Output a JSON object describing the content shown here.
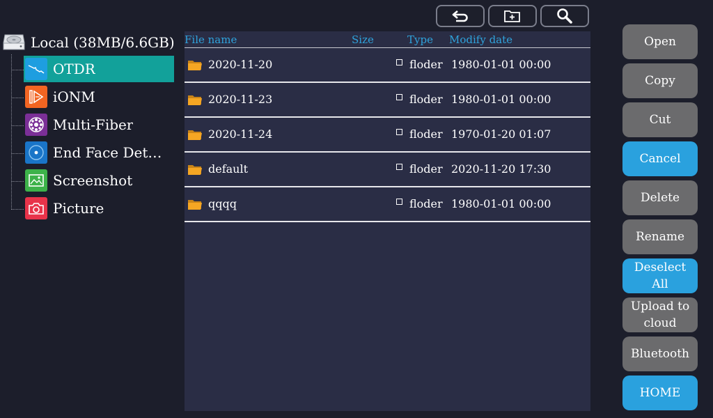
{
  "toolbar": {
    "back_icon": "return-arrow-icon",
    "new_folder_icon": "new-folder-icon",
    "search_icon": "search-icon"
  },
  "tree": {
    "root_label": "Local (38MB/6.6GB)",
    "root_icon": "hard-drive-icon",
    "items": [
      {
        "label": "OTDR",
        "icon": "otdr-trace-icon",
        "color": "#1e9ee0",
        "selected": true
      },
      {
        "label": "iONM",
        "icon": "ionm-icon",
        "color": "#f26522"
      },
      {
        "label": "Multi-Fiber",
        "icon": "multi-fiber-icon",
        "color": "#7b2f97"
      },
      {
        "label": "End Face Detection",
        "icon": "end-face-icon",
        "color": "#1a75c8"
      },
      {
        "label": "Screenshot",
        "icon": "screenshot-icon",
        "color": "#3db24a"
      },
      {
        "label": "Picture",
        "icon": "camera-icon",
        "color": "#e8334a"
      }
    ]
  },
  "file_list": {
    "columns": {
      "name": "File name",
      "size": "Size",
      "type": "Type",
      "date": "Modify date"
    },
    "rows": [
      {
        "name": "2020-11-20",
        "size": "",
        "type": "floder",
        "date": "1980-01-01 00:00"
      },
      {
        "name": "2020-11-23",
        "size": "",
        "type": "floder",
        "date": "1980-01-01 00:00"
      },
      {
        "name": "2020-11-24",
        "size": "",
        "type": "floder",
        "date": "1970-01-20 01:07"
      },
      {
        "name": "default",
        "size": "",
        "type": "floder",
        "date": "2020-11-20 17:30"
      },
      {
        "name": "qqqq",
        "size": "",
        "type": "floder",
        "date": "1980-01-01 00:00"
      }
    ]
  },
  "actions": {
    "open": "Open",
    "copy": "Copy",
    "cut": "Cut",
    "cancel": "Cancel",
    "delete": "Delete",
    "rename": "Rename",
    "deselect_all": "Deselect All",
    "upload": "Upload to cloud",
    "bluetooth": "Bluetooth",
    "home": "HOME"
  },
  "colors": {
    "background": "#1c1e2b",
    "panel": "#2a2d45",
    "accent_teal": "#12a19a",
    "accent_blue": "#2aa1de",
    "button_gray": "#6b6b6d",
    "header_text": "#2fa3dc",
    "folder": "#f5a623"
  }
}
